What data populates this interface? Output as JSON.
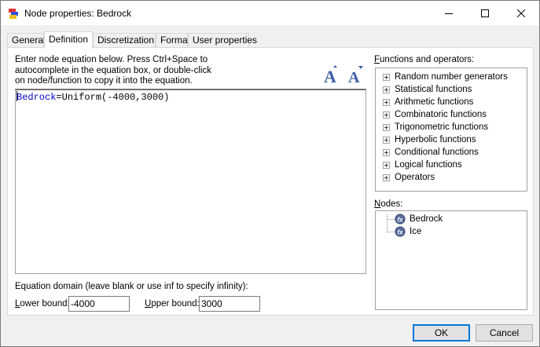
{
  "window": {
    "title": "Node properties: Bedrock",
    "controls": {
      "minimize": "minimize-icon",
      "maximize": "maximize-icon",
      "close": "close-icon"
    }
  },
  "tabs": [
    {
      "label": "General",
      "active": false
    },
    {
      "label": "Definition",
      "active": true
    },
    {
      "label": "Discretization",
      "active": false
    },
    {
      "label": "Format",
      "active": false
    },
    {
      "label": "User properties",
      "active": false
    }
  ],
  "definition": {
    "instructions": [
      "Enter node equation below. Press Ctrl+Space to",
      "autocomplete in the equation box, or double-click",
      "on node/function to copy it into the equation."
    ],
    "equation": {
      "node": "Bedrock",
      "rest": "=Uniform(-4000,3000)"
    },
    "functions_label_first": "F",
    "functions_label_rest": "unctions and operators:",
    "functions": [
      "Random number generators",
      "Statistical functions",
      "Arithmetic functions",
      "Combinatoric functions",
      "Trigonometric functions",
      "Hyperbolic functions",
      "Conditional functions",
      "Logical functions",
      "Operators"
    ],
    "nodes_label_first": "N",
    "nodes_label_rest": "odes:",
    "nodes": [
      "Bedrock",
      "Ice"
    ],
    "domain_label": "Equation domain (leave blank or use inf to specify infinity):",
    "lower_label_first": "L",
    "lower_label_rest": "ower bound:",
    "lower_value": "-4000",
    "upper_label_first": "U",
    "upper_label_rest": "pper bound:",
    "upper_value": "3000"
  },
  "buttons": {
    "ok": "OK",
    "cancel": "Cancel"
  },
  "colors": {
    "accent": "#0078d7",
    "node_ref": "#0000cc"
  }
}
